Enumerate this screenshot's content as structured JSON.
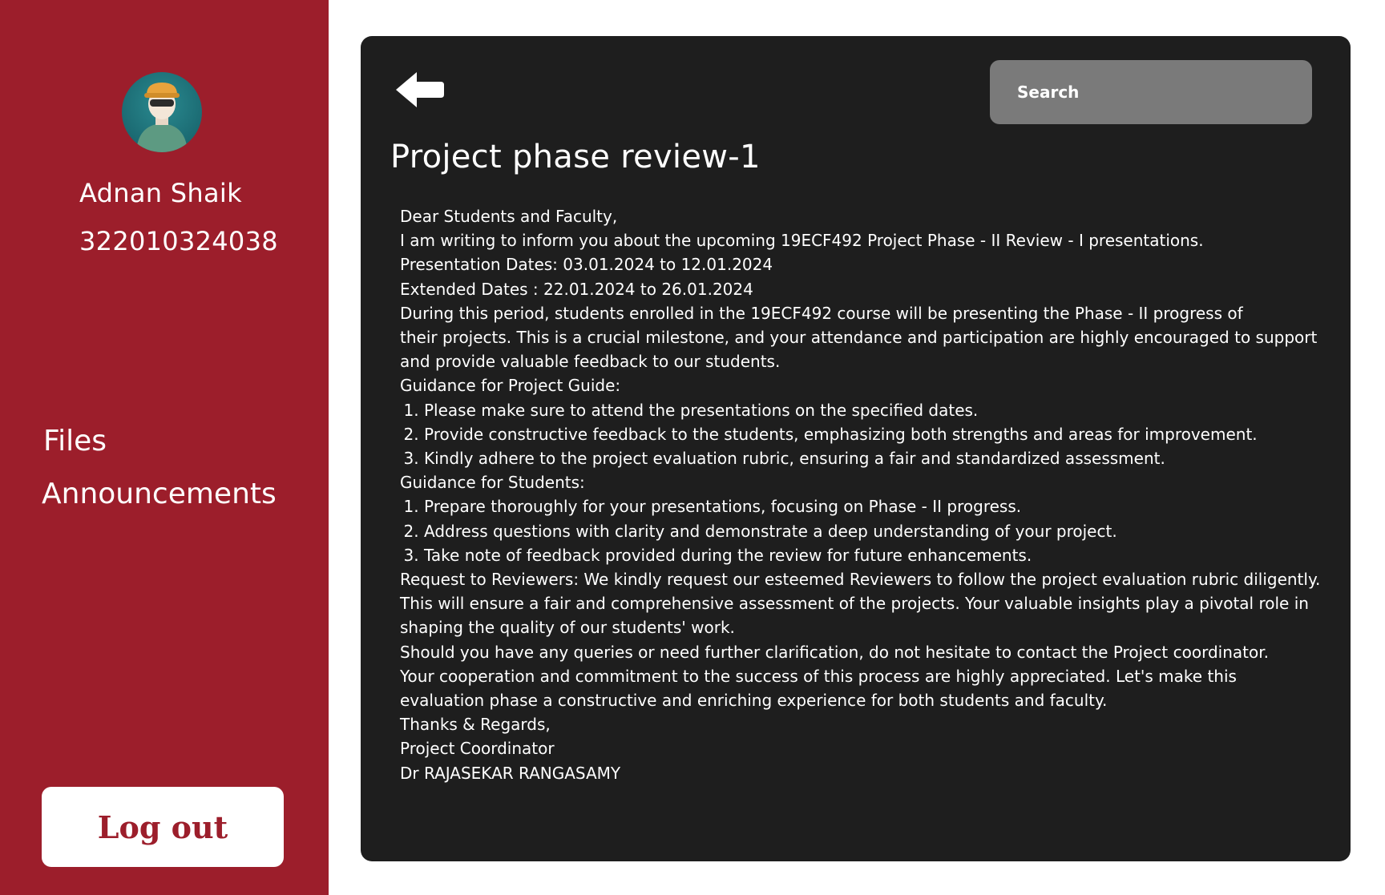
{
  "user": {
    "name": "Adnan Shaik",
    "id": "322010324038"
  },
  "nav": {
    "files": "Files",
    "announcements": "Announcements"
  },
  "logout_label": "Log out",
  "search": {
    "placeholder": "Search"
  },
  "announcement": {
    "title": "Project phase review-1",
    "greeting": "Dear Students and Faculty,",
    "intro": "I am writing to inform you about the upcoming 19ECF492 Project Phase - II Review - I presentations.",
    "presentation_dates": "Presentation Dates: 03.01.2024 to 12.01.2024",
    "extended_dates": "Extended Dates : 22.01.2024 to 26.01.2024",
    "period_lines": [
      "During this period, students enrolled in the 19ECF492 course will be presenting the Phase - II progress of",
      "their projects. This is a crucial milestone, and your attendance and participation are highly encouraged to support",
      "and provide valuable feedback to our students."
    ],
    "guide_heading": "Guidance for Project Guide:",
    "guide_items": [
      "Please make sure to attend the presentations on the specified dates.",
      "Provide constructive feedback to the students, emphasizing both strengths and areas for improvement.",
      "Kindly adhere to the project evaluation rubric, ensuring a fair and standardized assessment."
    ],
    "students_heading": "Guidance for Students:",
    "student_items": [
      "Prepare thoroughly for your presentations, focusing on Phase - II progress.",
      "Address questions with clarity and demonstrate a deep understanding of your project.",
      "Take note of feedback provided during the review for future enhancements."
    ],
    "reviewers_lines": [
      "Request to Reviewers: We kindly request our esteemed Reviewers to follow the project evaluation rubric diligently.",
      "This will ensure a fair and comprehensive assessment of the projects. Your valuable insights play a pivotal role in",
      "shaping the quality of our students' work."
    ],
    "queries": "Should you have any queries or need further clarification, do not hesitate to contact the Project coordinator.",
    "cooperation_lines": [
      "Your cooperation and commitment to the success of this process are highly appreciated. Let's make this",
      "evaluation phase a constructive and enriching experience for both students and faculty."
    ],
    "sign_off": "Thanks & Regards,",
    "sender_role": "Project Coordinator",
    "sender_name": "Dr RAJASEKAR RANGASAMY"
  },
  "colors": {
    "sidebar": "#9c1e2b",
    "panel": "#1e1e1e",
    "search": "#7a7a7a"
  }
}
